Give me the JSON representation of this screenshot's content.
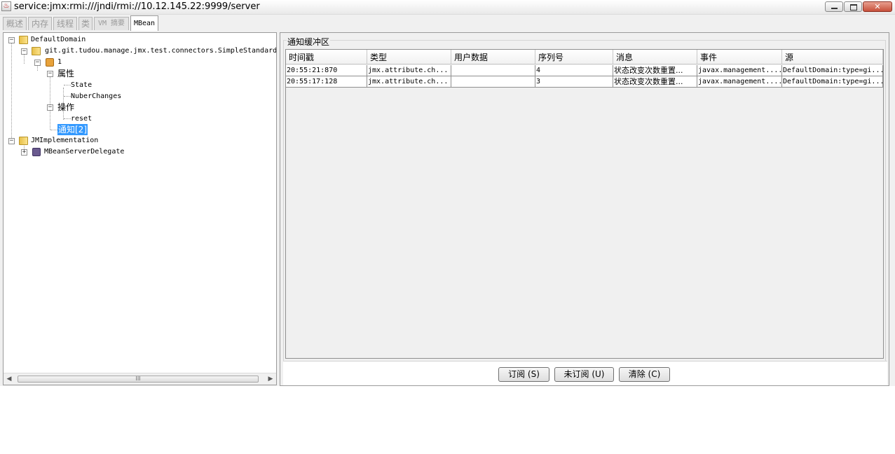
{
  "window": {
    "title": "service:jmx:rmi:///jndi/rmi://10.12.145.22:9999/server",
    "close_label": "✕"
  },
  "tabs": [
    {
      "label": "概述"
    },
    {
      "label": "内存"
    },
    {
      "label": "线程"
    },
    {
      "label": "类"
    },
    {
      "label": "VM 摘要"
    },
    {
      "label": "MBean"
    }
  ],
  "tree": {
    "default_domain": "DefaultDomain",
    "simple_standard": "git.git.tudou.manage.jmx.test.connectors.SimpleStandard",
    "instance": "1",
    "attributes": "属性",
    "attr_state": "State",
    "attr_nuber_changes": "NuberChanges",
    "operations": "操作",
    "op_reset": "reset",
    "notifications": "通知[2]",
    "jmimplementation": "JMImplementation",
    "mbean_server_delegate": "MBeanServerDelegate",
    "scroll_grip": "III"
  },
  "notifications": {
    "title": "通知缓冲区",
    "columns": [
      "时间戳",
      "类型",
      "用户数据",
      "序列号",
      "消息",
      "事件",
      "源"
    ],
    "rows": [
      [
        "20:55:21:870",
        "jmx.attribute.ch...",
        "",
        "4",
        "状态改变次数重置...",
        "javax.management....",
        "DefaultDomain:type=gi..."
      ],
      [
        "20:55:17:128",
        "jmx.attribute.ch...",
        "",
        "3",
        "状态改变次数重置...",
        "javax.management....",
        "DefaultDomain:type=gi..."
      ]
    ]
  },
  "buttons": {
    "subscribe": "订阅 (S)",
    "unsubscribe": "未订阅 (U)",
    "clear": "清除 (C)"
  },
  "colors": {
    "selection": "#3399ff",
    "connection_indicator": "#3a9a2a"
  }
}
